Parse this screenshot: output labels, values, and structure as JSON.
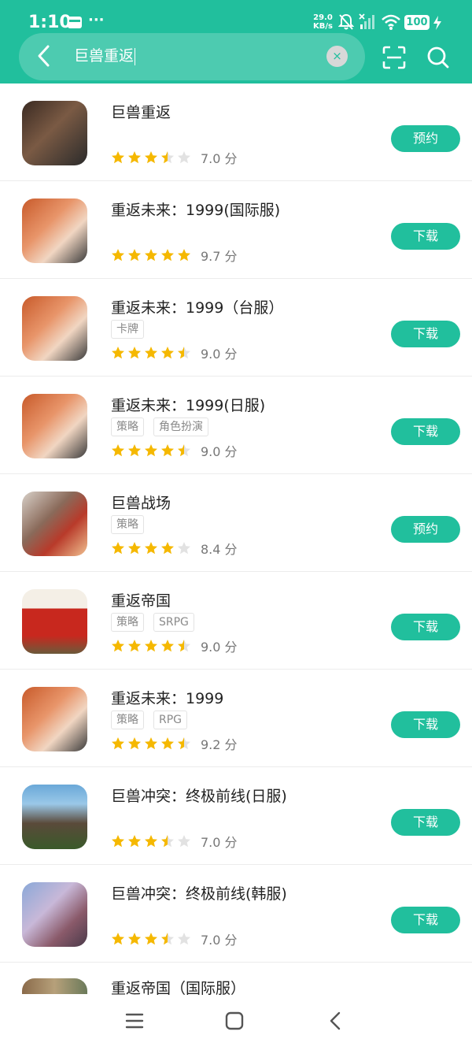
{
  "status_bar": {
    "time": "1:10",
    "more": "···",
    "net_speed_value": "29.0",
    "net_speed_unit": "KB/s",
    "battery": "100"
  },
  "search": {
    "query": "巨兽重返",
    "clear_glyph": "×"
  },
  "results": [
    {
      "name": "巨兽重返",
      "tags": [],
      "stars": 3.5,
      "score": "7.0 分",
      "action": "预约",
      "icon": "dinosaur-skeleton-game-icon"
    },
    {
      "name": "重返未来：1999(国际服)",
      "tags": [],
      "stars": 5,
      "score": "9.7 分",
      "action": "下载",
      "icon": "anime-girl-game-icon"
    },
    {
      "name": "重返未来：1999（台服）",
      "tags": [
        "卡牌"
      ],
      "stars": 4.5,
      "score": "9.0 分",
      "action": "下载",
      "icon": "anime-girl-game-icon"
    },
    {
      "name": "重返未来：1999(日服)",
      "tags": [
        "策略",
        "角色扮演"
      ],
      "stars": 4.5,
      "score": "9.0 分",
      "action": "下载",
      "icon": "anime-girl-game-icon"
    },
    {
      "name": "巨兽战场",
      "tags": [
        "策略"
      ],
      "stars": 4,
      "score": "8.4 分",
      "action": "预约",
      "icon": "mech-dinosaur-game-icon"
    },
    {
      "name": "重返帝国",
      "tags": [
        "策略",
        "SRPG"
      ],
      "stars": 4.5,
      "score": "9.0 分",
      "action": "下载",
      "icon": "empire-game-icon"
    },
    {
      "name": "重返未来：1999",
      "tags": [
        "策略",
        "RPG"
      ],
      "stars": 4.5,
      "score": "9.2 分",
      "action": "下载",
      "icon": "anime-girl-game-icon"
    },
    {
      "name": "巨兽冲突：终极前线(日服)",
      "tags": [],
      "stars": 3.5,
      "score": "7.0 分",
      "action": "下载",
      "icon": "t-rex-game-icon"
    },
    {
      "name": "巨兽冲突：终极前线(韩服)",
      "tags": [],
      "stars": 3.5,
      "score": "7.0 分",
      "action": "下载",
      "icon": "t-rex-game-icon"
    }
  ],
  "partial_result": {
    "name": "重返帝国（国际服）"
  },
  "colors": {
    "accent": "#21bf9d",
    "star": "#f5b800",
    "star_empty": "#e2e2e2"
  }
}
